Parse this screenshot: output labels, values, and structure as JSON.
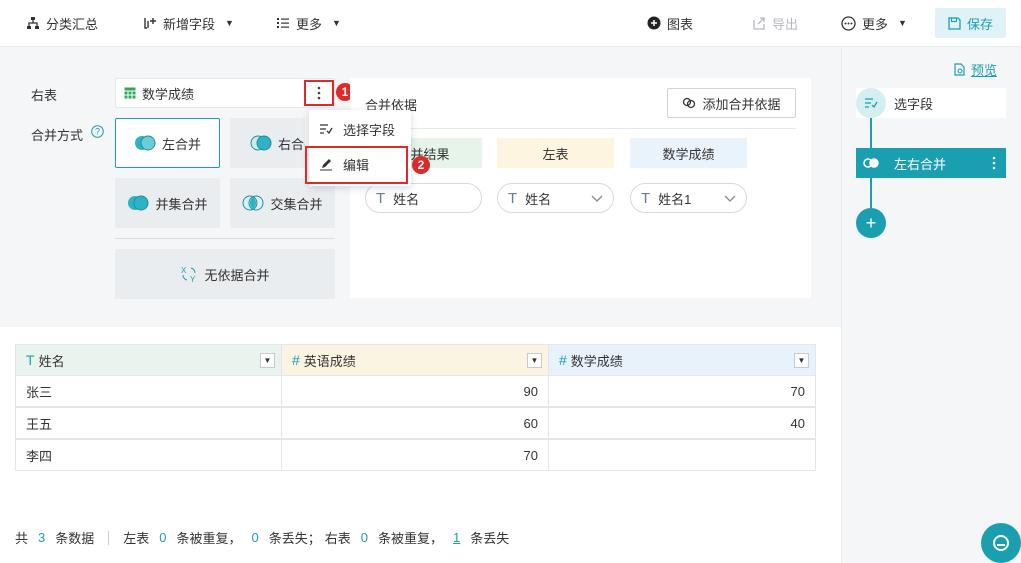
{
  "toolbar": {
    "group_summary": "分类汇总",
    "add_field": "新增字段",
    "more_left": "更多",
    "chart": "图表",
    "export": "导出",
    "more_right": "更多",
    "save": "保存"
  },
  "config": {
    "right_table_label": "右表",
    "right_table_value": "数学成绩",
    "merge_mode_label": "合并方式",
    "modes": [
      "左合并",
      "右合并",
      "并集合并",
      "交集合并"
    ],
    "no_basis": "无依据合并"
  },
  "basis": {
    "title": "合并依据",
    "add_button": "添加合并依据",
    "col_headers": [
      "合并结果",
      "左表",
      "数学成绩"
    ],
    "fields": [
      "姓名",
      "姓名",
      "姓名1"
    ]
  },
  "menu": {
    "select_field": "选择字段",
    "edit": "编辑"
  },
  "badges": [
    "1",
    "2"
  ],
  "right_panel": {
    "preview": "预览",
    "node1": "选字段",
    "node2": "左右合并"
  },
  "table": {
    "headers": [
      "姓名",
      "英语成绩",
      "数学成绩"
    ],
    "rows": [
      [
        "张三",
        "90",
        "70"
      ],
      [
        "王五",
        "60",
        "40"
      ],
      [
        "李四",
        "70",
        ""
      ]
    ]
  },
  "footer": {
    "total_prefix": "共",
    "total_count": "3",
    "total_suffix": "条数据",
    "left_label": "左表",
    "left_dup": "0",
    "dup_text": "条被重复，",
    "left_lost": "0",
    "lost_text_semi": "条丢失；",
    "right_label": "右表",
    "right_dup": "0",
    "dup_text2": "条被重复，",
    "right_lost": "1",
    "lost_text": "条丢失"
  },
  "colors": {
    "accent": "#1a9fb0",
    "highlight_red": "#e02a2a",
    "merge_result_bg": "#e6f4ea",
    "left_table_bg": "#fdf5e0",
    "right_table_bg": "#e8f3fc"
  }
}
